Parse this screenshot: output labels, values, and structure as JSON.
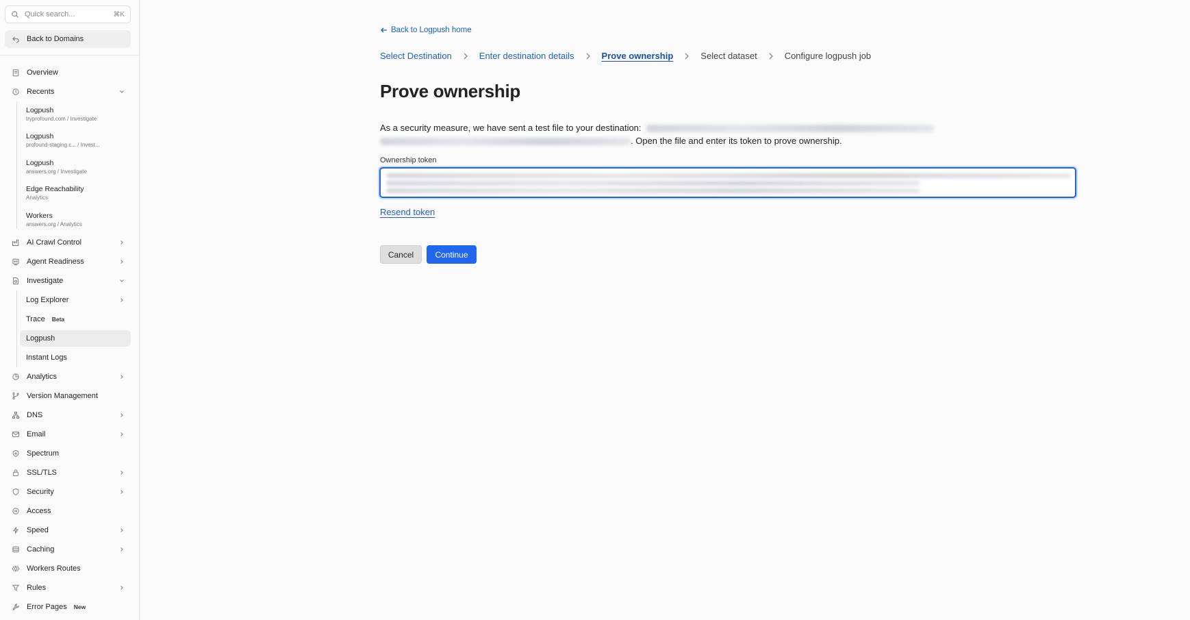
{
  "sidebar": {
    "search_placeholder": "Quick search...",
    "search_shortcut": "⌘K",
    "back_label": "Back to Domains",
    "overview": "Overview",
    "recents_label": "Recents",
    "recents": [
      {
        "title": "Logpush",
        "subtitle": "tryprofound.com  /  Investigate"
      },
      {
        "title": "Logpush",
        "subtitle": "profound-staging.c...  /  Invest..."
      },
      {
        "title": "Logpush",
        "subtitle": "answers.org  /  Investigate"
      },
      {
        "title": "Edge Reachability",
        "subtitle": "Analytics"
      },
      {
        "title": "Workers",
        "subtitle": "answers.org  /  Analytics"
      }
    ],
    "ai_crawl": "AI Crawl Control",
    "agent_readiness": "Agent Readiness",
    "investigate": "Investigate",
    "investigate_items": {
      "log_explorer": "Log Explorer",
      "trace": "Trace",
      "trace_badge": "Beta",
      "logpush": "Logpush",
      "instant_logs": "Instant Logs"
    },
    "analytics": "Analytics",
    "version_management": "Version Management",
    "dns": "DNS",
    "email": "Email",
    "spectrum": "Spectrum",
    "ssl_tls": "SSL/TLS",
    "security": "Security",
    "access": "Access",
    "speed": "Speed",
    "caching": "Caching",
    "workers_routes": "Workers Routes",
    "rules": "Rules",
    "error_pages": "Error Pages",
    "error_pages_badge": "New"
  },
  "main": {
    "back_link": "Back to Logpush home",
    "steps": [
      "Select Destination",
      "Enter destination details",
      "Prove ownership",
      "Select dataset",
      "Configure logpush job"
    ],
    "title": "Prove ownership",
    "desc_prefix": "As a security measure, we have sent a test file to your destination:",
    "desc_suffix": ". Open the file and enter its token to prove ownership.",
    "field_label": "Ownership token",
    "resend": "Resend token",
    "cancel": "Cancel",
    "continue": "Continue"
  },
  "colors": {
    "accent": "#2166ef",
    "link": "#1f5fbf"
  }
}
